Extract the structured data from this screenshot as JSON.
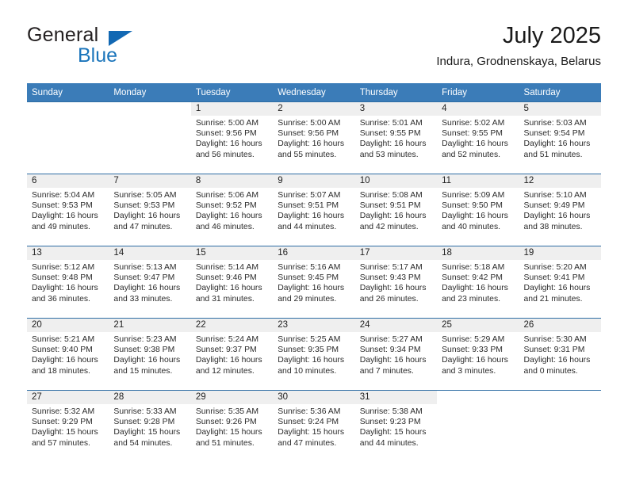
{
  "brand": {
    "name_top": "General",
    "name_bottom": "Blue",
    "accent_color": "#1b75bb",
    "triangle_color": "#1268b3"
  },
  "header": {
    "title": "July 2025",
    "subtitle": "Indura, Grodnenskaya, Belarus"
  },
  "calendar": {
    "header_bg": "#3b7cb8",
    "row_divider_color": "#2e6da4",
    "daynum_bg": "#efefef",
    "weekdays": [
      "Sunday",
      "Monday",
      "Tuesday",
      "Wednesday",
      "Thursday",
      "Friday",
      "Saturday"
    ],
    "weeks": [
      [
        {
          "day": "",
          "sunrise": "",
          "sunset": "",
          "daylight_line1": "",
          "daylight_line2": ""
        },
        {
          "day": "",
          "sunrise": "",
          "sunset": "",
          "daylight_line1": "",
          "daylight_line2": ""
        },
        {
          "day": "1",
          "sunrise": "Sunrise: 5:00 AM",
          "sunset": "Sunset: 9:56 PM",
          "daylight_line1": "Daylight: 16 hours",
          "daylight_line2": "and 56 minutes."
        },
        {
          "day": "2",
          "sunrise": "Sunrise: 5:00 AM",
          "sunset": "Sunset: 9:56 PM",
          "daylight_line1": "Daylight: 16 hours",
          "daylight_line2": "and 55 minutes."
        },
        {
          "day": "3",
          "sunrise": "Sunrise: 5:01 AM",
          "sunset": "Sunset: 9:55 PM",
          "daylight_line1": "Daylight: 16 hours",
          "daylight_line2": "and 53 minutes."
        },
        {
          "day": "4",
          "sunrise": "Sunrise: 5:02 AM",
          "sunset": "Sunset: 9:55 PM",
          "daylight_line1": "Daylight: 16 hours",
          "daylight_line2": "and 52 minutes."
        },
        {
          "day": "5",
          "sunrise": "Sunrise: 5:03 AM",
          "sunset": "Sunset: 9:54 PM",
          "daylight_line1": "Daylight: 16 hours",
          "daylight_line2": "and 51 minutes."
        }
      ],
      [
        {
          "day": "6",
          "sunrise": "Sunrise: 5:04 AM",
          "sunset": "Sunset: 9:53 PM",
          "daylight_line1": "Daylight: 16 hours",
          "daylight_line2": "and 49 minutes."
        },
        {
          "day": "7",
          "sunrise": "Sunrise: 5:05 AM",
          "sunset": "Sunset: 9:53 PM",
          "daylight_line1": "Daylight: 16 hours",
          "daylight_line2": "and 47 minutes."
        },
        {
          "day": "8",
          "sunrise": "Sunrise: 5:06 AM",
          "sunset": "Sunset: 9:52 PM",
          "daylight_line1": "Daylight: 16 hours",
          "daylight_line2": "and 46 minutes."
        },
        {
          "day": "9",
          "sunrise": "Sunrise: 5:07 AM",
          "sunset": "Sunset: 9:51 PM",
          "daylight_line1": "Daylight: 16 hours",
          "daylight_line2": "and 44 minutes."
        },
        {
          "day": "10",
          "sunrise": "Sunrise: 5:08 AM",
          "sunset": "Sunset: 9:51 PM",
          "daylight_line1": "Daylight: 16 hours",
          "daylight_line2": "and 42 minutes."
        },
        {
          "day": "11",
          "sunrise": "Sunrise: 5:09 AM",
          "sunset": "Sunset: 9:50 PM",
          "daylight_line1": "Daylight: 16 hours",
          "daylight_line2": "and 40 minutes."
        },
        {
          "day": "12",
          "sunrise": "Sunrise: 5:10 AM",
          "sunset": "Sunset: 9:49 PM",
          "daylight_line1": "Daylight: 16 hours",
          "daylight_line2": "and 38 minutes."
        }
      ],
      [
        {
          "day": "13",
          "sunrise": "Sunrise: 5:12 AM",
          "sunset": "Sunset: 9:48 PM",
          "daylight_line1": "Daylight: 16 hours",
          "daylight_line2": "and 36 minutes."
        },
        {
          "day": "14",
          "sunrise": "Sunrise: 5:13 AM",
          "sunset": "Sunset: 9:47 PM",
          "daylight_line1": "Daylight: 16 hours",
          "daylight_line2": "and 33 minutes."
        },
        {
          "day": "15",
          "sunrise": "Sunrise: 5:14 AM",
          "sunset": "Sunset: 9:46 PM",
          "daylight_line1": "Daylight: 16 hours",
          "daylight_line2": "and 31 minutes."
        },
        {
          "day": "16",
          "sunrise": "Sunrise: 5:16 AM",
          "sunset": "Sunset: 9:45 PM",
          "daylight_line1": "Daylight: 16 hours",
          "daylight_line2": "and 29 minutes."
        },
        {
          "day": "17",
          "sunrise": "Sunrise: 5:17 AM",
          "sunset": "Sunset: 9:43 PM",
          "daylight_line1": "Daylight: 16 hours",
          "daylight_line2": "and 26 minutes."
        },
        {
          "day": "18",
          "sunrise": "Sunrise: 5:18 AM",
          "sunset": "Sunset: 9:42 PM",
          "daylight_line1": "Daylight: 16 hours",
          "daylight_line2": "and 23 minutes."
        },
        {
          "day": "19",
          "sunrise": "Sunrise: 5:20 AM",
          "sunset": "Sunset: 9:41 PM",
          "daylight_line1": "Daylight: 16 hours",
          "daylight_line2": "and 21 minutes."
        }
      ],
      [
        {
          "day": "20",
          "sunrise": "Sunrise: 5:21 AM",
          "sunset": "Sunset: 9:40 PM",
          "daylight_line1": "Daylight: 16 hours",
          "daylight_line2": "and 18 minutes."
        },
        {
          "day": "21",
          "sunrise": "Sunrise: 5:23 AM",
          "sunset": "Sunset: 9:38 PM",
          "daylight_line1": "Daylight: 16 hours",
          "daylight_line2": "and 15 minutes."
        },
        {
          "day": "22",
          "sunrise": "Sunrise: 5:24 AM",
          "sunset": "Sunset: 9:37 PM",
          "daylight_line1": "Daylight: 16 hours",
          "daylight_line2": "and 12 minutes."
        },
        {
          "day": "23",
          "sunrise": "Sunrise: 5:25 AM",
          "sunset": "Sunset: 9:35 PM",
          "daylight_line1": "Daylight: 16 hours",
          "daylight_line2": "and 10 minutes."
        },
        {
          "day": "24",
          "sunrise": "Sunrise: 5:27 AM",
          "sunset": "Sunset: 9:34 PM",
          "daylight_line1": "Daylight: 16 hours",
          "daylight_line2": "and 7 minutes."
        },
        {
          "day": "25",
          "sunrise": "Sunrise: 5:29 AM",
          "sunset": "Sunset: 9:33 PM",
          "daylight_line1": "Daylight: 16 hours",
          "daylight_line2": "and 3 minutes."
        },
        {
          "day": "26",
          "sunrise": "Sunrise: 5:30 AM",
          "sunset": "Sunset: 9:31 PM",
          "daylight_line1": "Daylight: 16 hours",
          "daylight_line2": "and 0 minutes."
        }
      ],
      [
        {
          "day": "27",
          "sunrise": "Sunrise: 5:32 AM",
          "sunset": "Sunset: 9:29 PM",
          "daylight_line1": "Daylight: 15 hours",
          "daylight_line2": "and 57 minutes."
        },
        {
          "day": "28",
          "sunrise": "Sunrise: 5:33 AM",
          "sunset": "Sunset: 9:28 PM",
          "daylight_line1": "Daylight: 15 hours",
          "daylight_line2": "and 54 minutes."
        },
        {
          "day": "29",
          "sunrise": "Sunrise: 5:35 AM",
          "sunset": "Sunset: 9:26 PM",
          "daylight_line1": "Daylight: 15 hours",
          "daylight_line2": "and 51 minutes."
        },
        {
          "day": "30",
          "sunrise": "Sunrise: 5:36 AM",
          "sunset": "Sunset: 9:24 PM",
          "daylight_line1": "Daylight: 15 hours",
          "daylight_line2": "and 47 minutes."
        },
        {
          "day": "31",
          "sunrise": "Sunrise: 5:38 AM",
          "sunset": "Sunset: 9:23 PM",
          "daylight_line1": "Daylight: 15 hours",
          "daylight_line2": "and 44 minutes."
        },
        {
          "day": "",
          "sunrise": "",
          "sunset": "",
          "daylight_line1": "",
          "daylight_line2": ""
        },
        {
          "day": "",
          "sunrise": "",
          "sunset": "",
          "daylight_line1": "",
          "daylight_line2": ""
        }
      ]
    ]
  }
}
